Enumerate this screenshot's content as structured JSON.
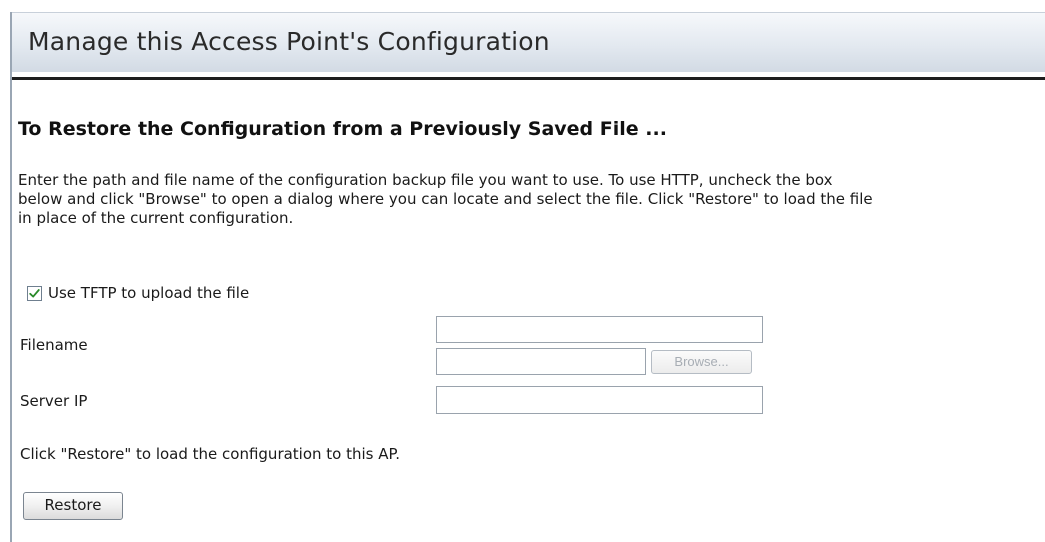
{
  "header": {
    "title": "Manage this Access Point's Configuration"
  },
  "section": {
    "title": "To Restore the Configuration from a Previously Saved File ...",
    "description": "Enter the path and file name of the configuration backup file you want to use. To use HTTP, uncheck the box\nbelow and click \"Browse\" to open a dialog where you can locate and select the file. Click \"Restore\" to load the file\nin place of the current configuration."
  },
  "form": {
    "tftp_checkbox": {
      "label": "Use TFTP to upload the file",
      "checked": true
    },
    "filename": {
      "label": "Filename",
      "tftp_value": "",
      "file_value": "",
      "browse_label": "Browse..."
    },
    "server_ip": {
      "label": "Server IP",
      "value": ""
    },
    "restore_note": "Click \"Restore\" to load the configuration to this AP.",
    "restore_label": "Restore"
  },
  "colors": {
    "header_gradient_top": "#f6f8fb",
    "header_gradient_bottom": "#d2dae4",
    "checkmark": "#2a8a2a",
    "disabled_text": "#a7adb4"
  },
  "icons": {
    "checkbox_mark": "checkmark-icon"
  }
}
